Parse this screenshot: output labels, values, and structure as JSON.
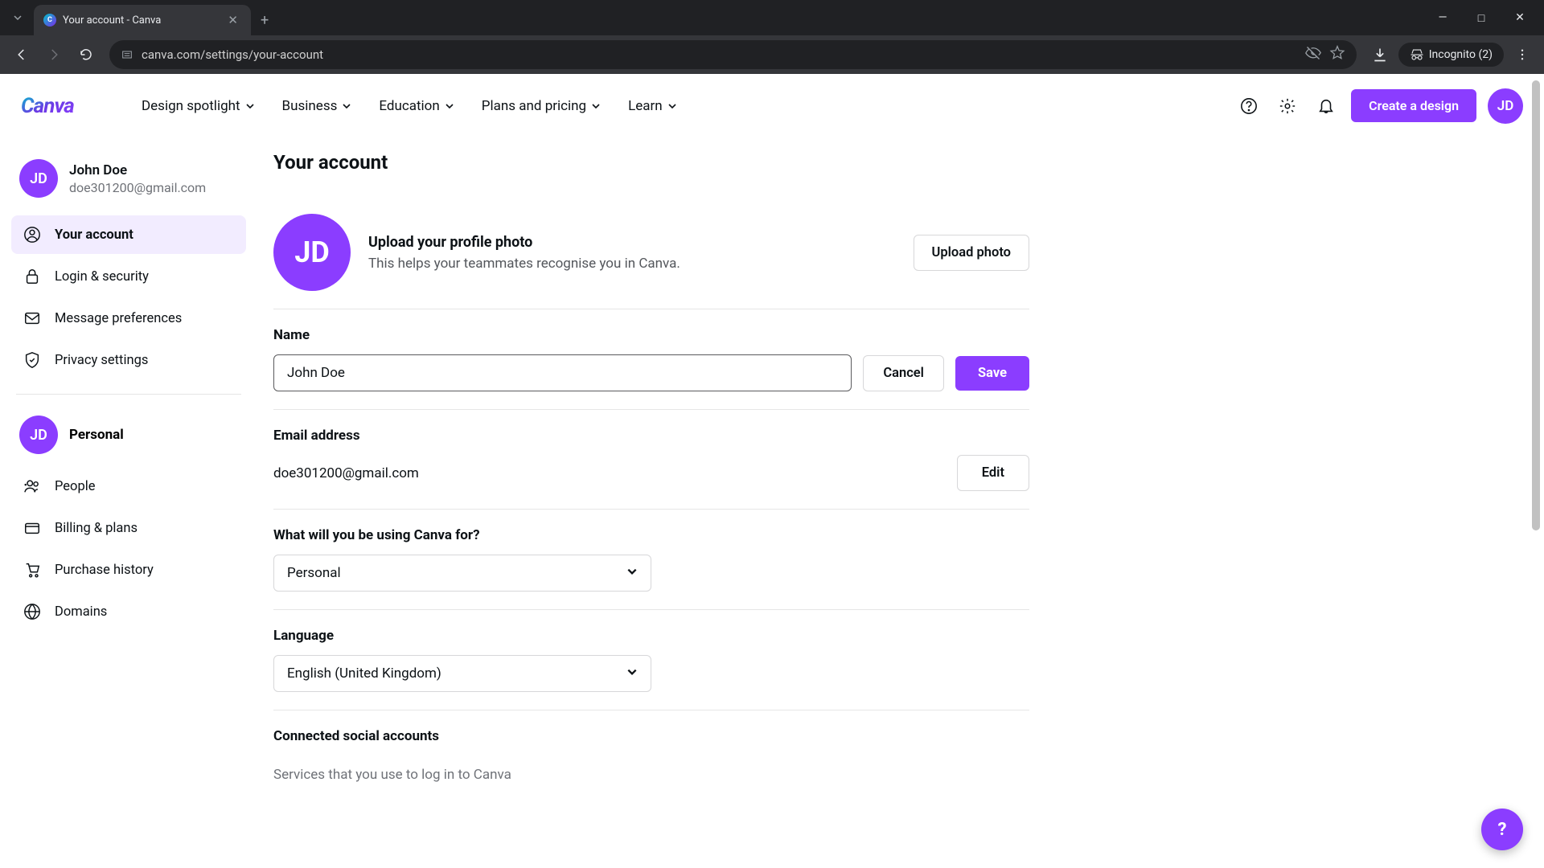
{
  "browser": {
    "tab_title": "Your account - Canva",
    "url": "canva.com/settings/your-account",
    "incognito_label": "Incognito (2)"
  },
  "header": {
    "nav": [
      "Design spotlight",
      "Business",
      "Education",
      "Plans and pricing",
      "Learn"
    ],
    "create_label": "Create a design",
    "avatar_initials": "JD"
  },
  "sidebar": {
    "user": {
      "initials": "JD",
      "name": "John Doe",
      "email": "doe301200@gmail.com"
    },
    "items_top": [
      {
        "label": "Your account",
        "icon": "user"
      },
      {
        "label": "Login & security",
        "icon": "lock"
      },
      {
        "label": "Message preferences",
        "icon": "mail"
      },
      {
        "label": "Privacy settings",
        "icon": "shield"
      }
    ],
    "team": {
      "initials": "JD",
      "name": "Personal"
    },
    "items_bottom": [
      {
        "label": "People",
        "icon": "people"
      },
      {
        "label": "Billing & plans",
        "icon": "card"
      },
      {
        "label": "Purchase history",
        "icon": "cart"
      },
      {
        "label": "Domains",
        "icon": "globe"
      }
    ]
  },
  "main": {
    "title": "Your account",
    "photo": {
      "initials": "JD",
      "heading": "Upload your profile photo",
      "sub": "This helps your teammates recognise you in Canva.",
      "button": "Upload photo"
    },
    "name": {
      "label": "Name",
      "value": "John Doe",
      "cancel": "Cancel",
      "save": "Save"
    },
    "email": {
      "label": "Email address",
      "value": "doe301200@gmail.com",
      "edit": "Edit"
    },
    "usage": {
      "label": "What will you be using Canva for?",
      "value": "Personal"
    },
    "language": {
      "label": "Language",
      "value": "English (United Kingdom)"
    },
    "connected": {
      "label": "Connected social accounts",
      "sub": "Services that you use to log in to Canva"
    }
  },
  "fab": "?"
}
